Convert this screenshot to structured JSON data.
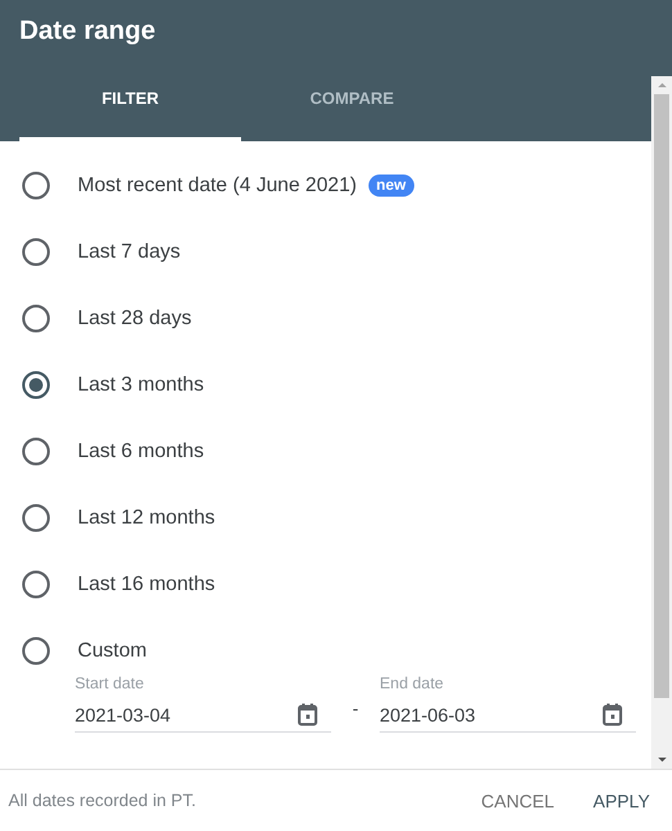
{
  "dialog": {
    "title": "Date range"
  },
  "tabs": [
    {
      "label": "FILTER",
      "selected": true
    },
    {
      "label": "COMPARE",
      "selected": false
    }
  ],
  "options": [
    {
      "label": "Most recent date (4 June 2021)",
      "badge": "new",
      "selected": false
    },
    {
      "label": "Last 7 days",
      "selected": false
    },
    {
      "label": "Last 28 days",
      "selected": false
    },
    {
      "label": "Last 3 months",
      "selected": true
    },
    {
      "label": "Last 6 months",
      "selected": false
    },
    {
      "label": "Last 12 months",
      "selected": false
    },
    {
      "label": "Last 16 months",
      "selected": false
    },
    {
      "label": "Custom",
      "selected": false
    }
  ],
  "custom_range": {
    "start": {
      "label": "Start date",
      "value": "2021-03-04"
    },
    "separator": "-",
    "end": {
      "label": "End date",
      "value": "2021-06-03"
    }
  },
  "footer": {
    "note": "All dates recorded in PT.",
    "buttons": [
      "CANCEL",
      "APPLY"
    ]
  }
}
